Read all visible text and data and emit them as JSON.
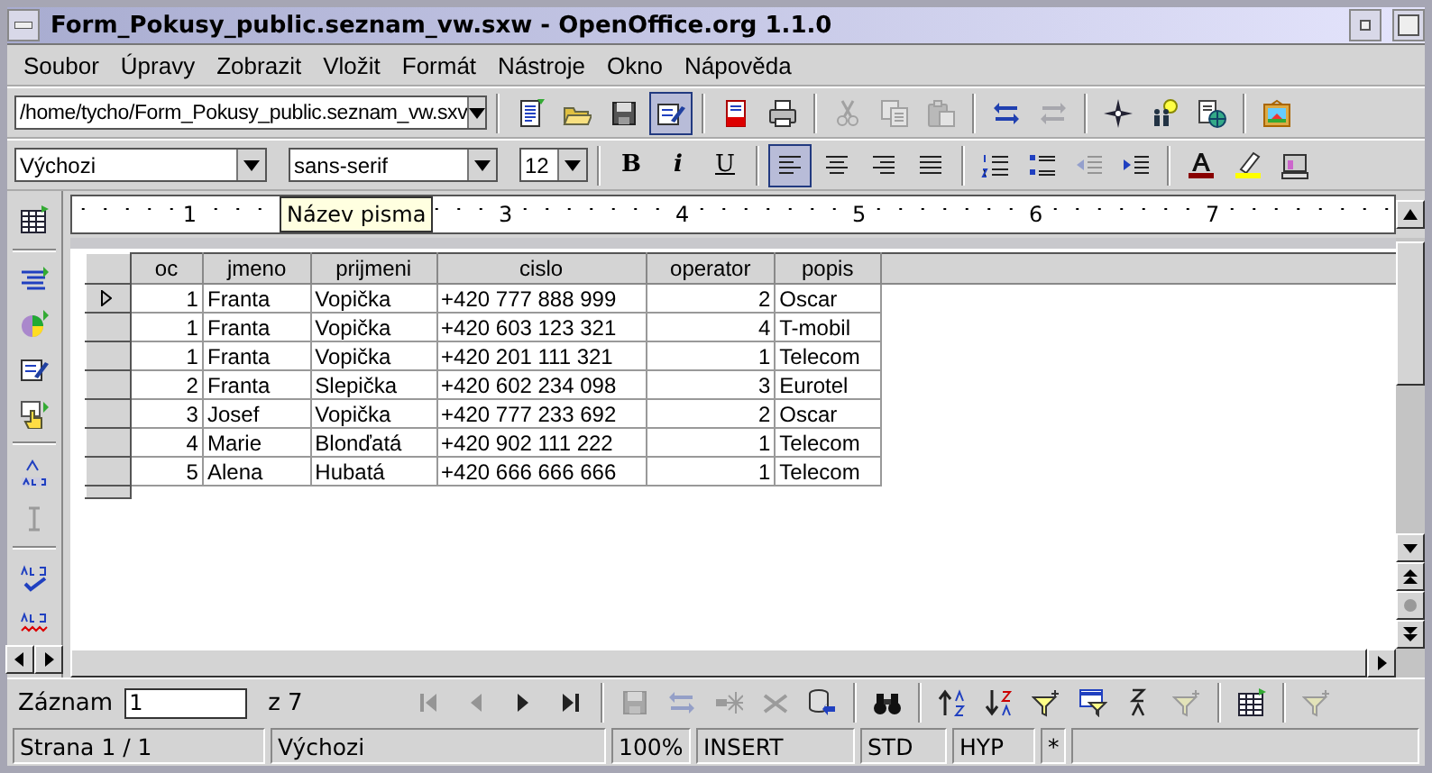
{
  "window": {
    "title": "Form_Pokusy_public.seznam_vw.sxw - OpenOffice.org 1.1.0"
  },
  "menu": [
    "Soubor",
    "Úpravy",
    "Zobrazit",
    "Vložit",
    "Formát",
    "Nástroje",
    "Okno",
    "Nápověda"
  ],
  "function_bar": {
    "url": "/home/tycho/Form_Pokusy_public.seznam_vw.sxv",
    "groups": [
      {
        "tools": [
          {
            "kind": "new-document",
            "disabled": false,
            "selected": false
          },
          {
            "kind": "open",
            "disabled": false,
            "selected": false
          },
          {
            "kind": "save",
            "disabled": false,
            "selected": false
          },
          {
            "kind": "edit-mode",
            "disabled": false,
            "selected": true
          }
        ]
      },
      {
        "tools": [
          {
            "kind": "export-pdf",
            "disabled": false,
            "selected": false
          },
          {
            "kind": "print",
            "disabled": false,
            "selected": false
          }
        ]
      },
      {
        "tools": [
          {
            "kind": "cut",
            "disabled": true,
            "selected": false
          },
          {
            "kind": "copy",
            "disabled": true,
            "selected": false
          },
          {
            "kind": "paste",
            "disabled": true,
            "selected": false
          }
        ]
      },
      {
        "tools": [
          {
            "kind": "undo",
            "disabled": false,
            "selected": false
          },
          {
            "kind": "redo",
            "disabled": true,
            "selected": false
          }
        ]
      },
      {
        "tools": [
          {
            "kind": "navigator",
            "disabled": false,
            "selected": false
          },
          {
            "kind": "gallery",
            "disabled": false,
            "selected": false
          },
          {
            "kind": "data-sources",
            "disabled": false,
            "selected": false
          }
        ]
      },
      {
        "tools": [
          {
            "kind": "image",
            "disabled": false,
            "selected": false
          }
        ]
      }
    ]
  },
  "object_bar": {
    "style": "Výchozi",
    "font": "sans-serif",
    "size": "12",
    "text_tools": [
      {
        "label": "B"
      },
      {
        "label": "i"
      },
      {
        "label": "U"
      }
    ],
    "groups": [
      {
        "tools": [
          {
            "kind": "align-left",
            "disabled": false,
            "selected": true
          },
          {
            "kind": "align-center",
            "disabled": false,
            "selected": false
          },
          {
            "kind": "align-right",
            "disabled": false,
            "selected": false
          },
          {
            "kind": "justify",
            "disabled": false,
            "selected": false
          }
        ]
      },
      {
        "tools": [
          {
            "kind": "numbering",
            "disabled": false,
            "selected": false
          },
          {
            "kind": "bullets",
            "disabled": false,
            "selected": false
          },
          {
            "kind": "indent-less",
            "disabled": true,
            "selected": false
          },
          {
            "kind": "indent-more",
            "disabled": false,
            "selected": false
          }
        ]
      },
      {
        "tools": [
          {
            "kind": "font-color",
            "disabled": false,
            "selected": false
          },
          {
            "kind": "highlight",
            "disabled": false,
            "selected": false
          },
          {
            "kind": "background",
            "disabled": false,
            "selected": false
          }
        ]
      }
    ]
  },
  "ruler": {
    "labels": [
      "1",
      "3",
      "4",
      "5",
      "6",
      "7"
    ],
    "tooltip": "Název pisma"
  },
  "side_groups": [
    {
      "tools": [
        {
          "kind": "table",
          "disabled": false
        }
      ]
    },
    {
      "tools": [
        {
          "kind": "fields",
          "disabled": false
        },
        {
          "kind": "chart",
          "disabled": false
        },
        {
          "kind": "form-edit",
          "disabled": false
        },
        {
          "kind": "hand",
          "disabled": false
        }
      ]
    },
    {
      "tools": [
        {
          "kind": "text-abc",
          "disabled": false
        },
        {
          "kind": "cursor",
          "disabled": true
        }
      ]
    },
    {
      "tools": [
        {
          "kind": "spellcheck",
          "disabled": false
        },
        {
          "kind": "autospell",
          "disabled": false
        }
      ]
    }
  ],
  "table": {
    "columns": [
      {
        "label": "oc",
        "kind": "number"
      },
      {
        "label": "jmeno",
        "kind": "text"
      },
      {
        "label": "prijmeni",
        "kind": "text"
      },
      {
        "label": "cislo",
        "kind": "text"
      },
      {
        "label": "operator",
        "kind": "number"
      },
      {
        "label": "popis",
        "kind": "text"
      }
    ],
    "rows": [
      {
        "selected": true,
        "cells": [
          "1",
          "Franta",
          "Vopička",
          "+420 777 888 999",
          "2",
          "Oscar"
        ]
      },
      {
        "selected": false,
        "cells": [
          "1",
          "Franta",
          "Vopička",
          "+420 603 123 321",
          "4",
          "T-mobil"
        ]
      },
      {
        "selected": false,
        "cells": [
          "1",
          "Franta",
          "Vopička",
          "+420 201 111 321",
          "1",
          "Telecom"
        ]
      },
      {
        "selected": false,
        "cells": [
          "2",
          "Franta",
          "Slepička",
          "+420 602 234 098",
          "3",
          "Eurotel"
        ]
      },
      {
        "selected": false,
        "cells": [
          "3",
          "Josef",
          "Vopička",
          "+420 777 233 692",
          "2",
          "Oscar"
        ]
      },
      {
        "selected": false,
        "cells": [
          "4",
          "Marie",
          "Blonďatá",
          "+420 902 111 222",
          "1",
          "Telecom"
        ]
      },
      {
        "selected": false,
        "cells": [
          "5",
          "Alena",
          "Hubatá",
          "+420 666 666 666",
          "1",
          "Telecom"
        ]
      }
    ]
  },
  "navigation": {
    "label": "Záznam",
    "record": "1",
    "total": "z 7",
    "groups": [
      {
        "tools": [
          {
            "kind": "first",
            "disabled": true
          },
          {
            "kind": "prev",
            "disabled": true
          },
          {
            "kind": "next",
            "disabled": false
          },
          {
            "kind": "last",
            "disabled": false
          }
        ]
      },
      {
        "tools": [
          {
            "kind": "save-record",
            "disabled": true
          },
          {
            "kind": "undo-record",
            "disabled": true
          },
          {
            "kind": "new-record",
            "disabled": true
          },
          {
            "kind": "delete-record",
            "disabled": true
          },
          {
            "kind": "refresh",
            "disabled": false
          }
        ]
      },
      {
        "tools": [
          {
            "kind": "find",
            "disabled": false
          }
        ]
      },
      {
        "tools": [
          {
            "kind": "sort-asc",
            "disabled": false
          },
          {
            "kind": "sort-desc",
            "disabled": false
          },
          {
            "kind": "autofilter",
            "disabled": false
          },
          {
            "kind": "filter",
            "disabled": false
          },
          {
            "kind": "sort",
            "disabled": false
          },
          {
            "kind": "remove-filter",
            "disabled": true
          }
        ]
      },
      {
        "tools": [
          {
            "kind": "data-to-text",
            "disabled": false
          }
        ]
      },
      {
        "tools": [
          {
            "kind": "apply-filter",
            "disabled": true
          }
        ]
      }
    ]
  },
  "status_bar": [
    "Strana 1 / 1",
    "Výchozi",
    "100%",
    "INSERT",
    "STD",
    "HYP",
    "*"
  ]
}
